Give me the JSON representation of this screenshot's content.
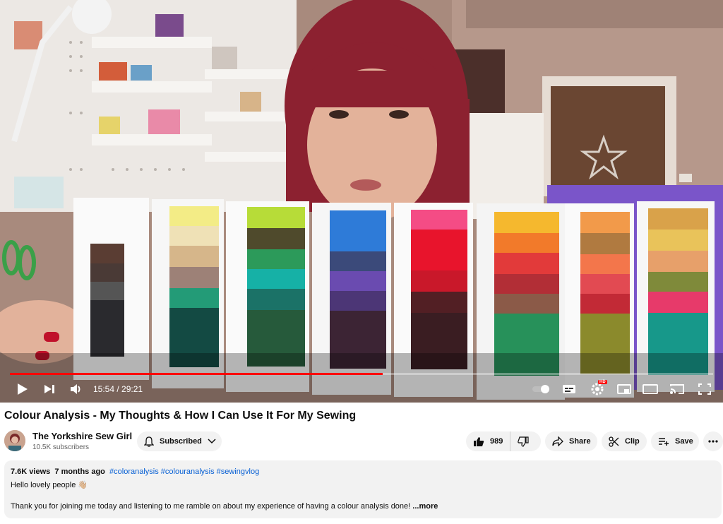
{
  "video": {
    "progress_fraction": 0.53,
    "time_current": "15:54",
    "time_separator": " / ",
    "time_total": "29:21",
    "hd_badge": "HD"
  },
  "title": "Colour Analysis - My Thoughts & How I Can Use It For My Sewing",
  "channel": {
    "name": "The Yorkshire Sew Girl",
    "subscribers": "10.5K subscribers"
  },
  "actions": {
    "subscribed_label": "Subscribed",
    "like_count": "989",
    "share_label": "Share",
    "clip_label": "Clip",
    "save_label": "Save"
  },
  "description": {
    "views": "7.6K views",
    "age": "7 months ago",
    "tags": "#coloranalysis #colouranalysis #sewingvlog",
    "line1": "Hello lovely people 👋🏼",
    "line3": "Thank you for joining me today and listening to me ramble on about my experience of having a colour analysis done!",
    "more_label": "...more"
  },
  "icons": {
    "play": "play-icon",
    "next": "next-icon",
    "volume": "volume-icon",
    "autoplay": "autoplay-toggle-icon",
    "captions": "subtitles-icon",
    "settings": "gear-icon",
    "miniplayer": "miniplayer-icon",
    "theater": "theater-icon",
    "cast": "cast-icon",
    "fullscreen": "fullscreen-icon",
    "bell": "bell-icon",
    "chevron": "chevron-down-icon",
    "like": "thumbs-up-icon",
    "dislike": "thumbs-down-icon",
    "share": "share-arrow-icon",
    "clip": "scissors-icon",
    "save": "playlist-add-icon",
    "more": "more-vert-icon"
  },
  "colors": {
    "progress": "#ff0000",
    "link": "#065fd4",
    "pill_bg": "#f2f2f2"
  }
}
